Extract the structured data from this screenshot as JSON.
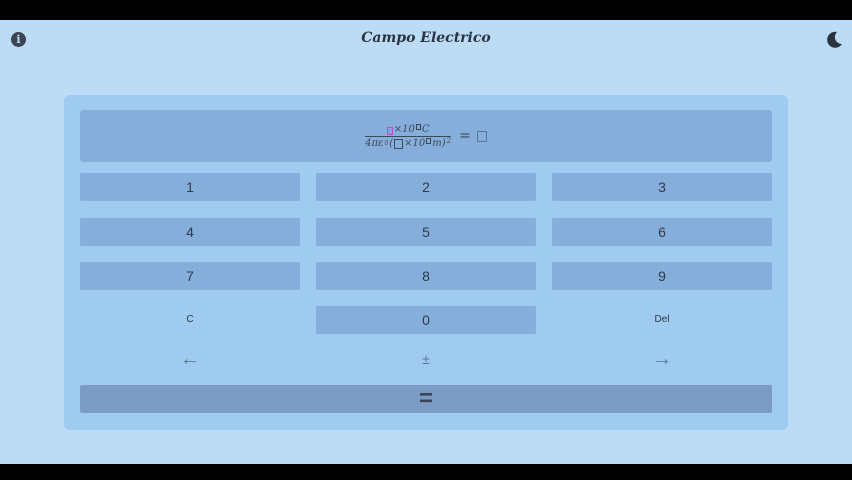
{
  "header": {
    "title": "Campo Electrico",
    "info_icon": "info-icon",
    "theme_icon": "moon-icon"
  },
  "display": {
    "numerator_unit": "C",
    "numerator_times": "×10",
    "denominator_prefix": "4πε",
    "denominator_sub": "0",
    "denominator_times": "×10",
    "denominator_unit": "m)",
    "denominator_exp": "2",
    "open_paren": "(",
    "equals": "="
  },
  "keypad": {
    "rows": [
      [
        "1",
        "2",
        "3"
      ],
      [
        "4",
        "5",
        "6"
      ],
      [
        "7",
        "8",
        "9"
      ],
      [
        "C",
        "0",
        "Del"
      ]
    ],
    "left_arrow": "←",
    "plus_minus": "±",
    "right_arrow": "→",
    "equals": "="
  },
  "colors": {
    "background": "#bcdcf6",
    "panel": "#9ecbef",
    "key": "#85aedb",
    "equals_key": "#7a9bc3",
    "cursor_placeholder": "#c04ad0"
  }
}
